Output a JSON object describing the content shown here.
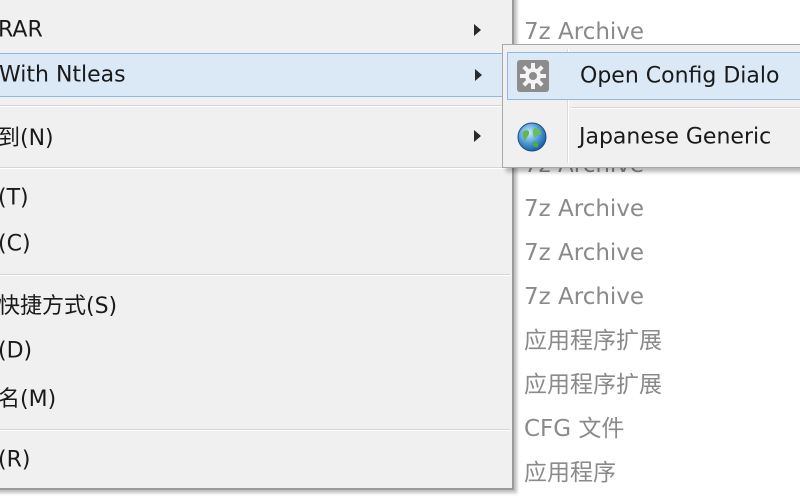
{
  "file_list": {
    "types": [
      "7z Archive",
      "7z Archive",
      "7z Archive",
      "7z Archive",
      "7z Archive",
      "7z Archive",
      "应用程序扩展",
      "应用程序扩展",
      "CFG 文件",
      "应用程序"
    ]
  },
  "context_menu": {
    "items": [
      {
        "label": "RAR",
        "has_submenu": true
      },
      {
        "label": "With Ntleas",
        "has_submenu": true,
        "highlighted": true
      },
      {
        "label": "到(N)",
        "has_submenu": true
      },
      {
        "label": "(T)"
      },
      {
        "label": "(C)"
      },
      {
        "label": "快捷方式(S)"
      },
      {
        "label": "(D)"
      },
      {
        "label": "名(M)"
      },
      {
        "label": "(R)"
      }
    ]
  },
  "submenu": {
    "items": [
      {
        "label": "Open Config Dialo",
        "icon": "gear-icon",
        "highlighted": true
      },
      {
        "label": "Japanese Generic",
        "icon": "globe-icon"
      }
    ]
  },
  "colors": {
    "menu_bg": "#f0f0f0",
    "highlight_bg": "#dbe8f6",
    "highlight_border": "#90b8e4",
    "type_text": "#8a8a8a"
  }
}
